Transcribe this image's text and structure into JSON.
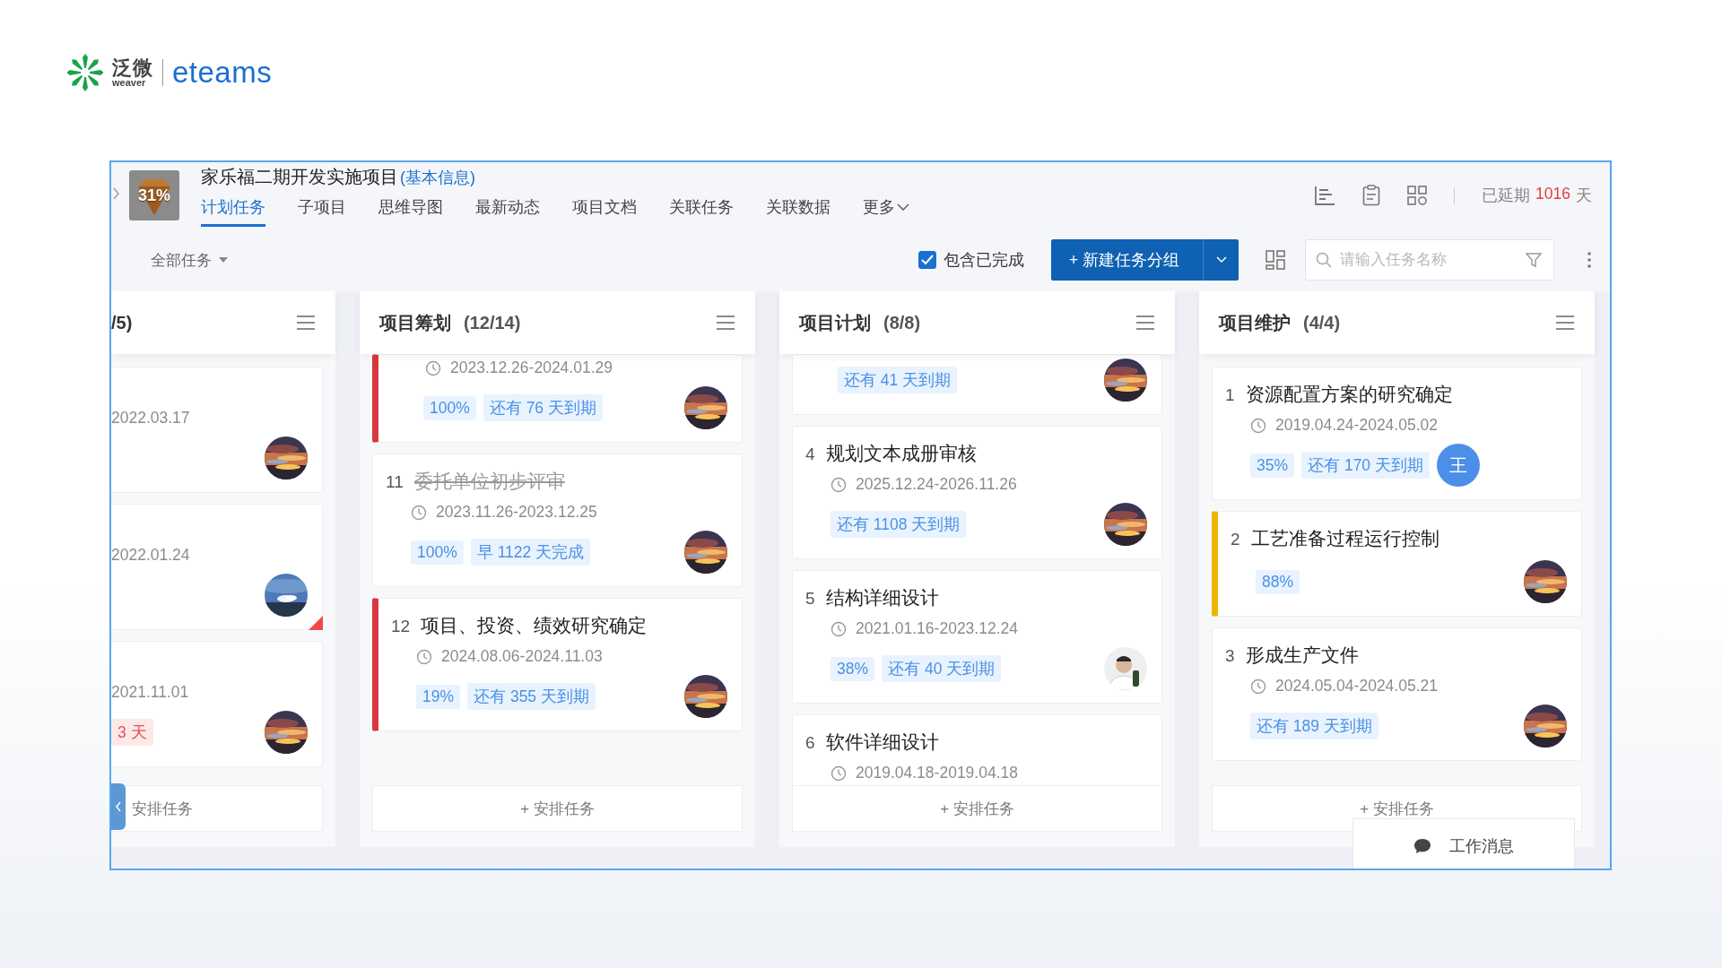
{
  "logo": {
    "brand_cn": "泛微",
    "brand_en": "weaver",
    "product": "eteams"
  },
  "project": {
    "progress": "31%",
    "title": "家乐福二期开发实施项目",
    "info_link": "(基本信息)",
    "overdue_label": "已延期",
    "overdue_days": "1016",
    "overdue_unit": "天"
  },
  "tabs": [
    {
      "label": "计划任务",
      "selected": true
    },
    {
      "label": "子项目",
      "selected": false
    },
    {
      "label": "思维导图",
      "selected": false
    },
    {
      "label": "最新动态",
      "selected": false
    },
    {
      "label": "项目文档",
      "selected": false
    },
    {
      "label": "关联任务",
      "selected": false
    },
    {
      "label": "关联数据",
      "selected": false
    },
    {
      "label": "更多",
      "selected": false,
      "kind": "menu"
    }
  ],
  "toolbar": {
    "filter": "全部任务",
    "include_done": {
      "label": "包含已完成",
      "checked": true
    },
    "new_group": "+ 新建任务分组",
    "search": {
      "placeholder": "请输入任务名称"
    }
  },
  "columns": [
    {
      "title": "/5)",
      "add_label": "安排任务",
      "cards": [
        {
          "date": "2022.03.17",
          "flagged": false,
          "avatar": {
            "kind": "picture"
          }
        },
        {
          "date": "2022.01.24",
          "flagged": true,
          "avatar": {
            "kind": "picture"
          }
        },
        {
          "date": "2021.11.01",
          "flagged": false,
          "tags": [
            {
              "text": "3 天",
              "kind": "overdue"
            }
          ],
          "avatar": {
            "kind": "picture"
          }
        }
      ]
    },
    {
      "title": "项目筹划",
      "count": "(12/14)",
      "add_label": "+ 安排任务",
      "cards": [
        {
          "date": "2023.12.26-2024.01.29",
          "flagged": false,
          "color": "#d9363e",
          "tags": [
            {
              "text": "100%",
              "kind": "progress"
            },
            {
              "text": "还有 76 天到期",
              "kind": "due"
            }
          ],
          "avatar": {
            "kind": "picture"
          }
        },
        {
          "number": "11",
          "title": "委托单位初步评审",
          "done": true,
          "flagged": false,
          "date": "2023.11.26-2023.12.25",
          "tags": [
            {
              "text": "100%",
              "kind": "progress"
            },
            {
              "text": "早 1122 天完成",
              "kind": "due"
            }
          ],
          "avatar": {
            "kind": "picture"
          }
        },
        {
          "number": "12",
          "title": "项目、投资、绩效研究确定",
          "done": false,
          "flagged": false,
          "color": "#d9363e",
          "date": "2024.08.06-2024.11.03",
          "tags": [
            {
              "text": "19%",
              "kind": "progress"
            },
            {
              "text": "还有 355 天到期",
              "kind": "due"
            }
          ],
          "avatar": {
            "kind": "picture"
          }
        }
      ]
    },
    {
      "title": "项目计划",
      "count": "(8/8)",
      "add_label": "+ 安排任务",
      "cards": [
        {
          "flagged": false,
          "tags": [
            {
              "text": "还有 41 天到期",
              "kind": "due"
            }
          ],
          "avatar": {
            "kind": "picture"
          }
        },
        {
          "number": "4",
          "title": "规划文本成册审核",
          "done": false,
          "flagged": false,
          "date": "2025.12.24-2026.11.26",
          "tags": [
            {
              "text": "还有 1108 天到期",
              "kind": "due"
            }
          ],
          "avatar": {
            "kind": "picture"
          }
        },
        {
          "number": "5",
          "title": "结构详细设计",
          "done": false,
          "flagged": false,
          "date": "2021.01.16-2023.12.24",
          "tags": [
            {
              "text": "38%",
              "kind": "progress"
            },
            {
              "text": "还有 40 天到期",
              "kind": "due"
            }
          ],
          "avatar": {
            "kind": "picture"
          }
        },
        {
          "number": "6",
          "title": "软件详细设计",
          "done": false,
          "flagged": false,
          "date": "2019.04.18-2019.04.18"
        }
      ]
    },
    {
      "title": "项目维护",
      "count": "(4/4)",
      "add_label": "+ 安排任务",
      "cards": [
        {
          "number": "1",
          "title": "资源配置方案的研究确定",
          "done": false,
          "flagged": false,
          "date": "2019.04.24-2024.05.02",
          "tags": [
            {
              "text": "35%",
              "kind": "progress"
            },
            {
              "text": "还有 170 天到期",
              "kind": "due"
            }
          ],
          "avatar": {
            "kind": "initial",
            "text": "王"
          }
        },
        {
          "number": "2",
          "title": "工艺准备过程运行控制",
          "done": false,
          "flagged": false,
          "color": "#f0b400",
          "tags": [
            {
              "text": "88%",
              "kind": "progress"
            }
          ],
          "avatar": {
            "kind": "picture"
          }
        },
        {
          "number": "3",
          "title": "形成生产文件",
          "done": false,
          "flagged": false,
          "date": "2024.05.04-2024.05.21",
          "tags": [
            {
              "text": "还有 189 天到期",
              "kind": "due"
            }
          ],
          "avatar": {
            "kind": "picture"
          }
        }
      ]
    }
  ],
  "chat": {
    "label": "工作消息"
  }
}
